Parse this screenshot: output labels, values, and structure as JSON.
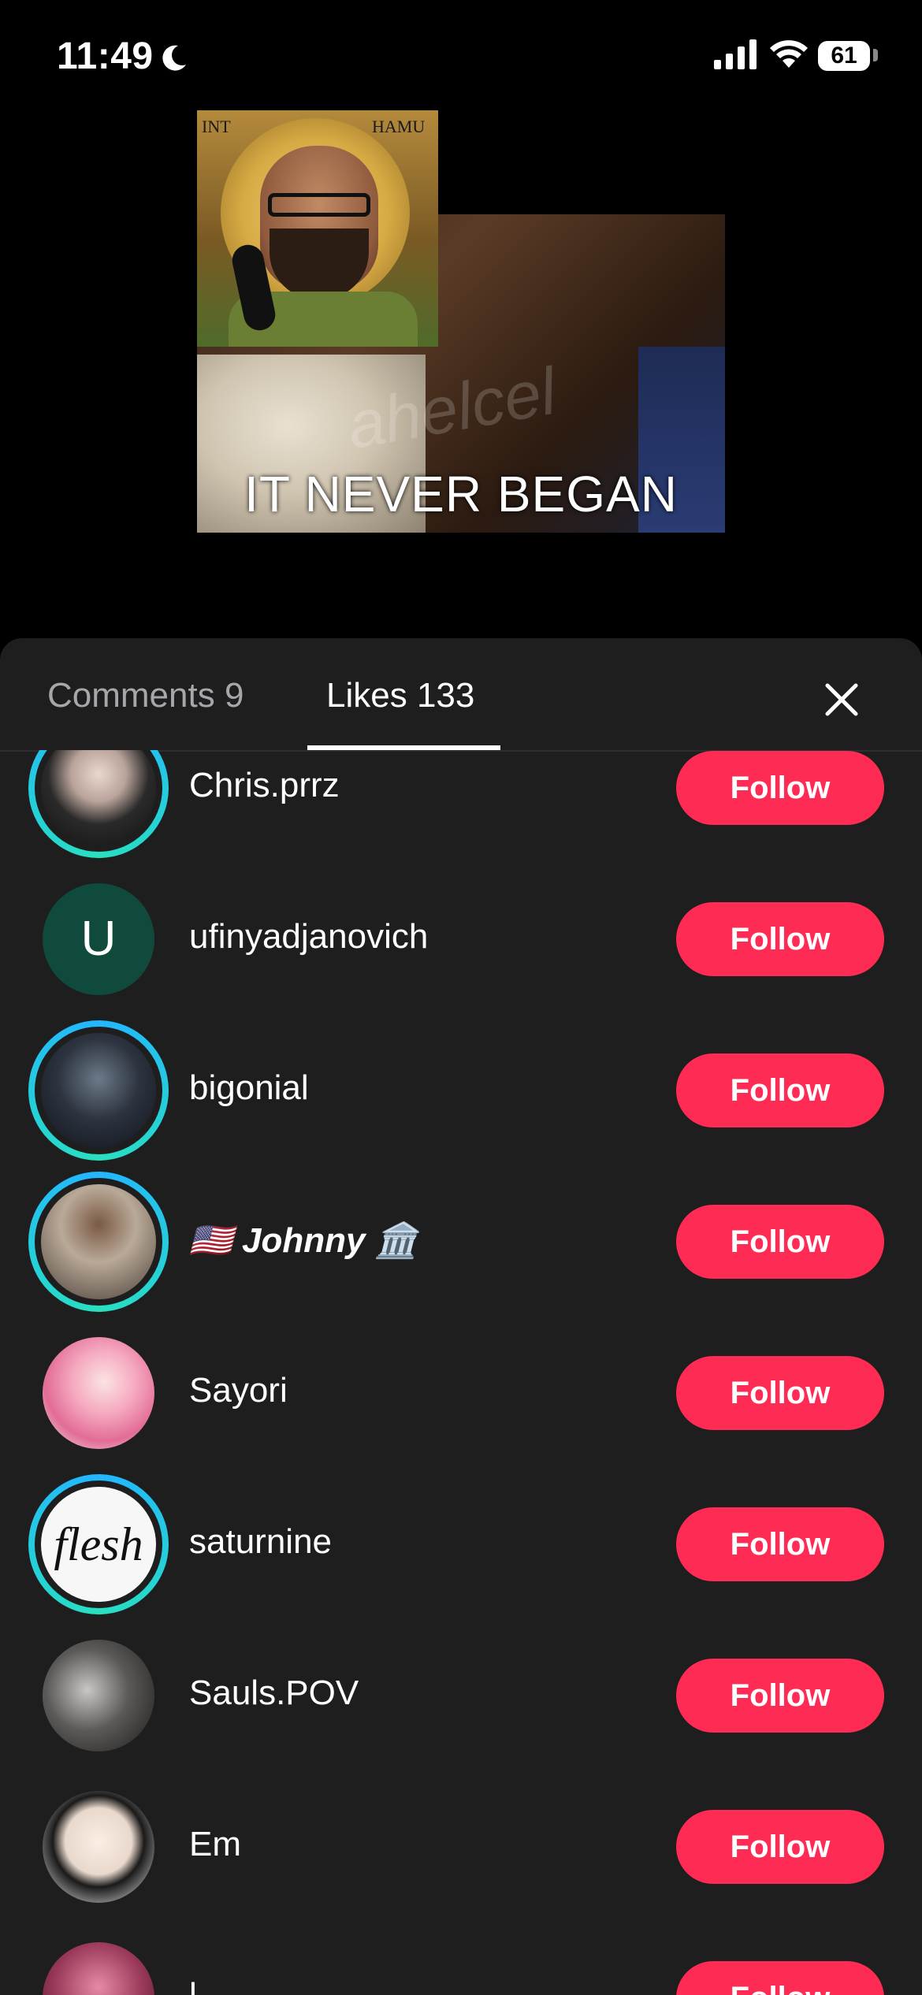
{
  "status_bar": {
    "time": "11:49",
    "battery": "61"
  },
  "video": {
    "caption": "IT NEVER BEGAN",
    "watermark": "ahelcel",
    "saint_left": "INT",
    "saint_right": "HAMU"
  },
  "tabs": {
    "comments": "Comments 9",
    "likes": "Likes 133"
  },
  "likes": [
    {
      "name": "Chris.prrz",
      "follow": "Follow"
    },
    {
      "name": "ufinyadjanovich",
      "initial": "U",
      "follow": "Follow"
    },
    {
      "name": "bigonial",
      "follow": "Follow"
    },
    {
      "name": "🇺🇸 Johnny 🏛️",
      "follow": "Follow"
    },
    {
      "name": "Sayori",
      "follow": "Follow"
    },
    {
      "name": "saturnine",
      "avatar_text": "flesh",
      "follow": "Follow"
    },
    {
      "name": "Sauls.POV",
      "follow": "Follow"
    },
    {
      "name": "Em",
      "follow": "Follow"
    },
    {
      "name": "l",
      "follow": "Follow"
    }
  ],
  "colors": {
    "follow_button": "#fe2c55",
    "sheet_bg": "#1e1e1f",
    "ring": "#22b6ff"
  }
}
